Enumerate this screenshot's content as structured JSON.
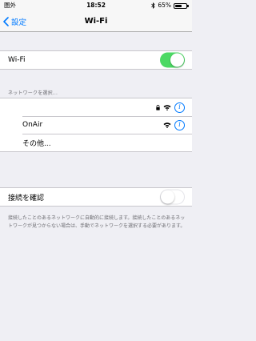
{
  "status_bar": {
    "carrier": "圏外",
    "time": "18:52",
    "battery": "65%",
    "battery_level": 0.65
  },
  "nav": {
    "back_label": "設定",
    "title": "Wi-Fi"
  },
  "wifi": {
    "label": "Wi-Fi",
    "enabled": true
  },
  "networks": {
    "header": "ネットワークを選択...",
    "items": [
      {
        "name": "",
        "secured": true
      },
      {
        "name": "OnAir",
        "secured": false
      }
    ],
    "other_label": "その他..."
  },
  "ask_to_join": {
    "label": "接続を確認",
    "enabled": false,
    "footer": "接続したことのあるネットワークに自動的に接続します。接続したことのあるネットワークが見つからない場合は、手動でネットワークを選択する必要があります。"
  },
  "colors": {
    "accent": "#007aff",
    "toggle_on": "#4cd964",
    "background": "#efeff4"
  }
}
